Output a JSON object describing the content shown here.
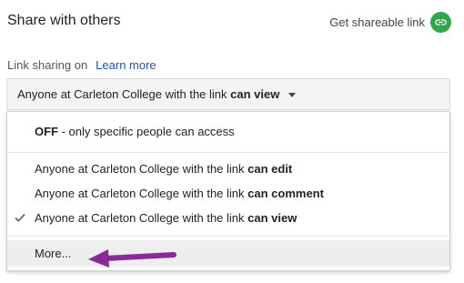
{
  "header": {
    "title": "Share with others",
    "shareable_link_label": "Get shareable link"
  },
  "link_sharing": {
    "label": "Link sharing on",
    "learn_more": "Learn more"
  },
  "dropdown": {
    "selected_prefix": "Anyone at Carleton College with the link ",
    "selected_bold": "can view"
  },
  "menu": {
    "off_bold": "OFF",
    "off_rest": " - only specific people can access",
    "items": [
      {
        "prefix": "Anyone at Carleton College with the link ",
        "bold": "can edit",
        "checked": false
      },
      {
        "prefix": "Anyone at Carleton College with the link ",
        "bold": "can comment",
        "checked": false
      },
      {
        "prefix": "Anyone at Carleton College with the link ",
        "bold": "can view",
        "checked": true
      }
    ],
    "more": "More..."
  },
  "colors": {
    "link_green": "#2fa74a",
    "learn_more_blue": "#1a55c8",
    "annotation_arrow": "#8a2a9a"
  },
  "icons": {
    "shareable": "link-icon",
    "dropdown": "caret-down-icon",
    "selected": "checkmark-icon",
    "annotation": "arrow-left-icon"
  }
}
